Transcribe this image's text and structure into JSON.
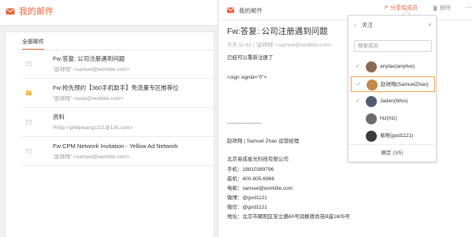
{
  "app": {
    "title": "我的邮件",
    "tab_all": "全部邮件"
  },
  "mails": [
    {
      "subject": "Fw:答复: 公司注册遇到问题",
      "sender": "\"赵祥翔\" <samuel@worktile.com>",
      "icon": "envelope-icon"
    },
    {
      "subject": "Fw:抢先预约【360手机助手】免流量专区推荐位",
      "sender": "\"赵祥翔\" <wow@worktile.com>",
      "icon": "envelope-open-icon"
    },
    {
      "subject": "资料",
      "sender": "Philip <philipwang1121@126.com>",
      "icon": "envelope-icon"
    },
    {
      "subject": "Fw:CPM Network Invitation - Yellow Ad Network",
      "sender": "\"赵祥翔\" <samuel@worktile.com>",
      "icon": "envelope-icon"
    }
  ],
  "pane": {
    "title": "我的邮件",
    "share_label": "分享给成员",
    "delete_label": "删除",
    "more_label": "···"
  },
  "message": {
    "subject": "Fw:答复: 公司注册遇到问题",
    "meta": "今天 11:42 | \"赵祥翔\" <samuel@worktile.com>",
    "body": "已经可以重新注册了",
    "signid": "<sign signid=\"0\">",
    "dashes": "--------------------",
    "sig_name": "赵祥翔 | Samuel Zhao     运营经理",
    "sig_company": "北京易成星光科技有限公司",
    "sig_mobile": "手机：18810389796",
    "sig_phone": "座机：400-805-6966",
    "sig_email": "电邮：samuel@worktile.com",
    "sig_weibo": "微博：@god1121",
    "sig_weixin": "微信：@god1121",
    "sig_address": "地址：北京市朝阳区安立路60号润枫德尚苑B座1605号"
  },
  "popover": {
    "back": "‹",
    "title": "关注",
    "close": "×",
    "search_placeholder": "搜索成员",
    "members": [
      {
        "name": "anytao(anylive)",
        "checked": true,
        "selected": false,
        "avatar_color": "#8a6a55"
      },
      {
        "name": "赵祥翔(SamuelZhao)",
        "checked": true,
        "selected": true,
        "avatar_color": "#c48a4a"
      },
      {
        "name": "Jaden(Woo)",
        "checked": true,
        "selected": false,
        "avatar_color": "#4f5d73"
      },
      {
        "name": "htz(htz)",
        "checked": false,
        "selected": false,
        "avatar_color": "#6d6d6d"
      },
      {
        "name": "易哈(god1121)",
        "checked": false,
        "selected": false,
        "avatar_color": "#3b3b3b"
      }
    ],
    "confirm": "确定 (3/5)"
  },
  "colors": {
    "accent": "#e8643c",
    "selected_border": "#f0a44b"
  }
}
